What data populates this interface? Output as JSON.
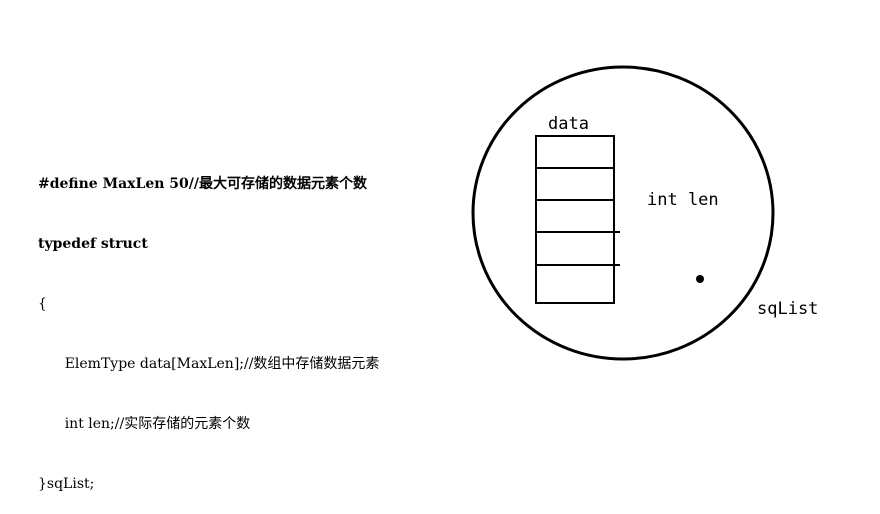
{
  "code": {
    "lines": [
      "#define MaxLen 50//最大可存储的数据元素个数",
      "typedef struct",
      "{",
      "      ElemType data[MaxLen];//数组中存储数据元素",
      "      int len;//实际存储的元素个数",
      "}sqList;"
    ]
  },
  "diagram": {
    "array_label": "data",
    "field_label": "int len",
    "struct_label": "sqList",
    "array_cells": 5
  }
}
